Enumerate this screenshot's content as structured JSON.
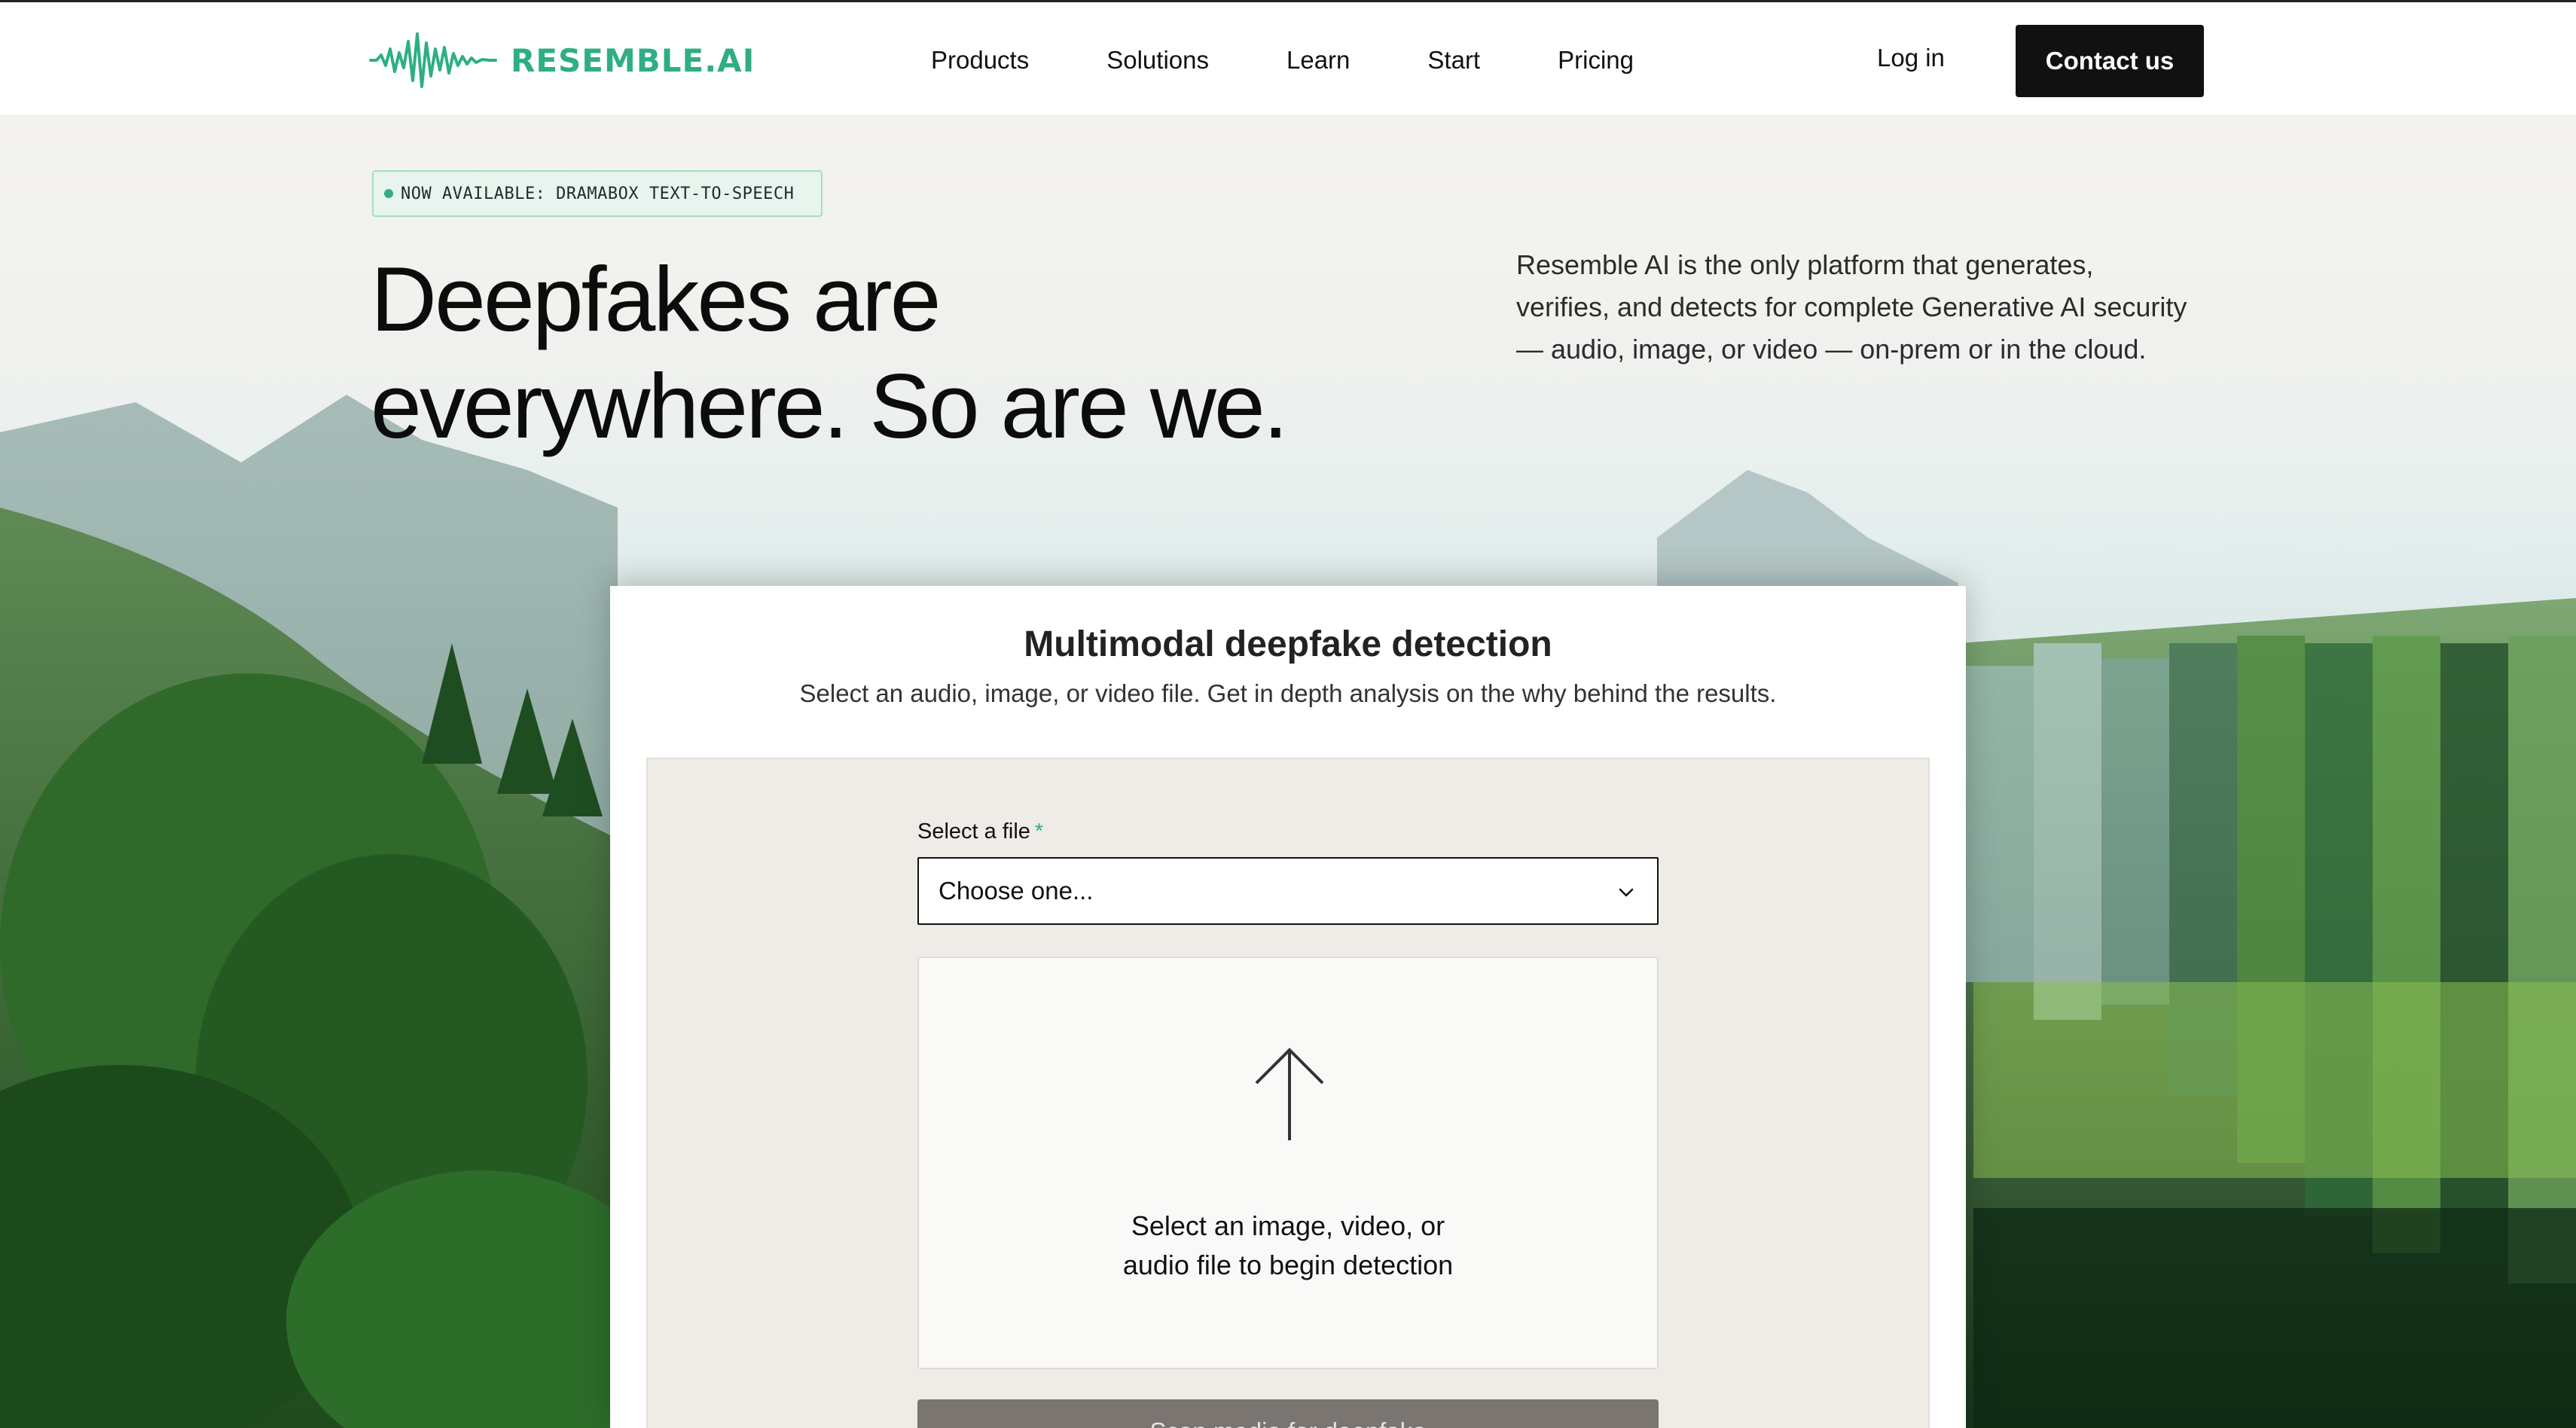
{
  "brand": {
    "name": "RESEMBLE.AI",
    "accent": "#2fae86"
  },
  "nav": {
    "links": [
      "Products",
      "Solutions",
      "Learn",
      "Start",
      "Pricing"
    ],
    "login": "Log in",
    "contact": "Contact us"
  },
  "hero": {
    "badge": "NOW AVAILABLE: DRAMABOX TEXT-TO-SPEECH",
    "headline_line1": "Deepfakes are",
    "headline_line2": "everywhere. So are we.",
    "tagline": "Resemble AI is the only platform that generates, verifies, and detects for complete Generative AI security — audio, image, or video — on-prem or in the cloud."
  },
  "detector": {
    "title": "Multimodal deepfake detection",
    "subtitle": "Select an audio, image, or video file. Get in depth analysis on the why behind the results.",
    "field_label": "Select a file",
    "required_mark": "*",
    "select_value": "Choose one...",
    "dropzone_line1": "Select an image, video, or",
    "dropzone_line2": "audio file to begin detection",
    "scan_button": "Scan media for deepfake"
  },
  "icons": [
    "waveform-logo-icon",
    "chevron-down-icon",
    "upload-arrow-icon",
    "status-dot-icon"
  ]
}
